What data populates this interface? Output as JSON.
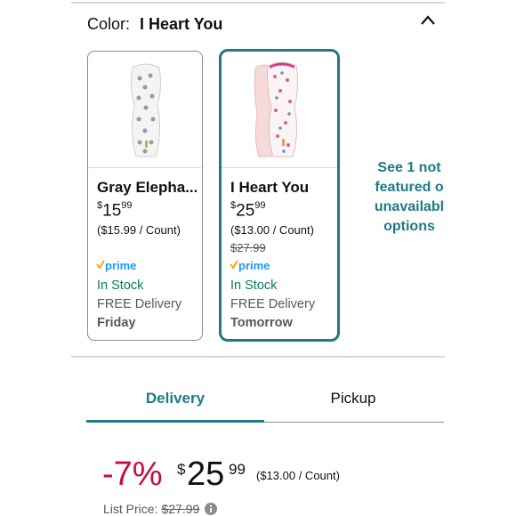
{
  "color_selector": {
    "label": "Color:",
    "selected": "I Heart You",
    "icon": "chevron-up-icon"
  },
  "variants": [
    {
      "name": "Gray Elepha...",
      "price_symbol": "$",
      "price_whole": "15",
      "price_fraction": "99",
      "price_per_count": "($15.99 / Count)",
      "list_price": "",
      "prime": "prime",
      "stock": "In Stock",
      "delivery": "FREE Delivery",
      "delivery_day": "Friday",
      "selected": false
    },
    {
      "name": "I Heart You",
      "price_symbol": "$",
      "price_whole": "25",
      "price_fraction": "99",
      "price_per_count": "($13.00 / Count)",
      "list_price": "$27.99",
      "prime": "prime",
      "stock": "In Stock",
      "delivery": "FREE Delivery",
      "delivery_day": "Tomorrow",
      "selected": true
    }
  ],
  "see_more": {
    "line1": "See 1 not",
    "line2": "featured o",
    "line3": "unavailabl",
    "line4": "options"
  },
  "tabs": [
    {
      "label": "Delivery",
      "active": true
    },
    {
      "label": "Pickup",
      "active": false
    }
  ],
  "buy_box": {
    "discount": "-7%",
    "price_symbol": "$",
    "price_whole": "25",
    "price_fraction": "99",
    "price_per_count": "($13.00 / Count)",
    "list_price_label": "List Price:",
    "list_price": "$27.99",
    "info_icon": "info-icon"
  },
  "colors": {
    "accent": "#1e7a86",
    "discount": "#cc0c39",
    "stock": "#067d62",
    "prime": "#1a98ff"
  }
}
